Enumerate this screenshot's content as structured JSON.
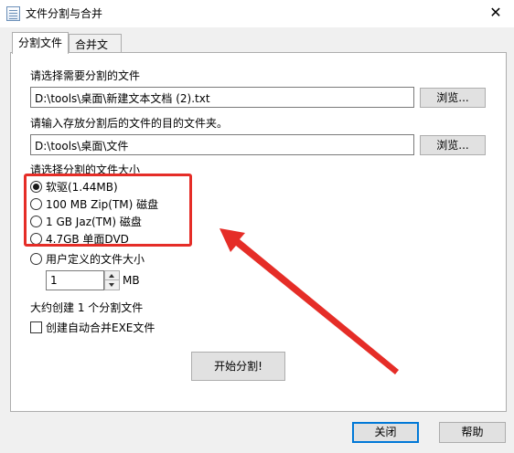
{
  "window": {
    "title": "文件分割与合并",
    "close_glyph": "✕"
  },
  "tabs": [
    {
      "label": "分割文件"
    },
    {
      "label": "合并文件"
    }
  ],
  "split": {
    "source_label": "请选择需要分割的文件",
    "source_path": "D:\\tools\\桌面\\新建文本文档 (2).txt",
    "browse_label": "浏览...",
    "dest_label": "请输入存放分割后的文件的目的文件夹。",
    "dest_path": "D:\\tools\\桌面\\文件",
    "size_label": "请选择分割的文件大小",
    "size_options": [
      {
        "label": "软驱(1.44MB)",
        "checked": true
      },
      {
        "label": "100 MB Zip(TM) 磁盘",
        "checked": false
      },
      {
        "label": "1 GB Jaz(TM) 磁盘",
        "checked": false
      },
      {
        "label": "4.7GB 单面DVD",
        "checked": false
      },
      {
        "label": "用户定义的文件大小",
        "checked": false
      }
    ],
    "custom_size_value": "1",
    "custom_size_unit": "MB",
    "estimate_text": "大约创建 1 个分割文件",
    "auto_merge_label": "创建自动合并EXE文件",
    "auto_merge_checked": false,
    "start_label": "开始分割!"
  },
  "footer": {
    "close_label": "关闭",
    "help_label": "帮助"
  },
  "annotation": {
    "color": "#e52d27"
  }
}
